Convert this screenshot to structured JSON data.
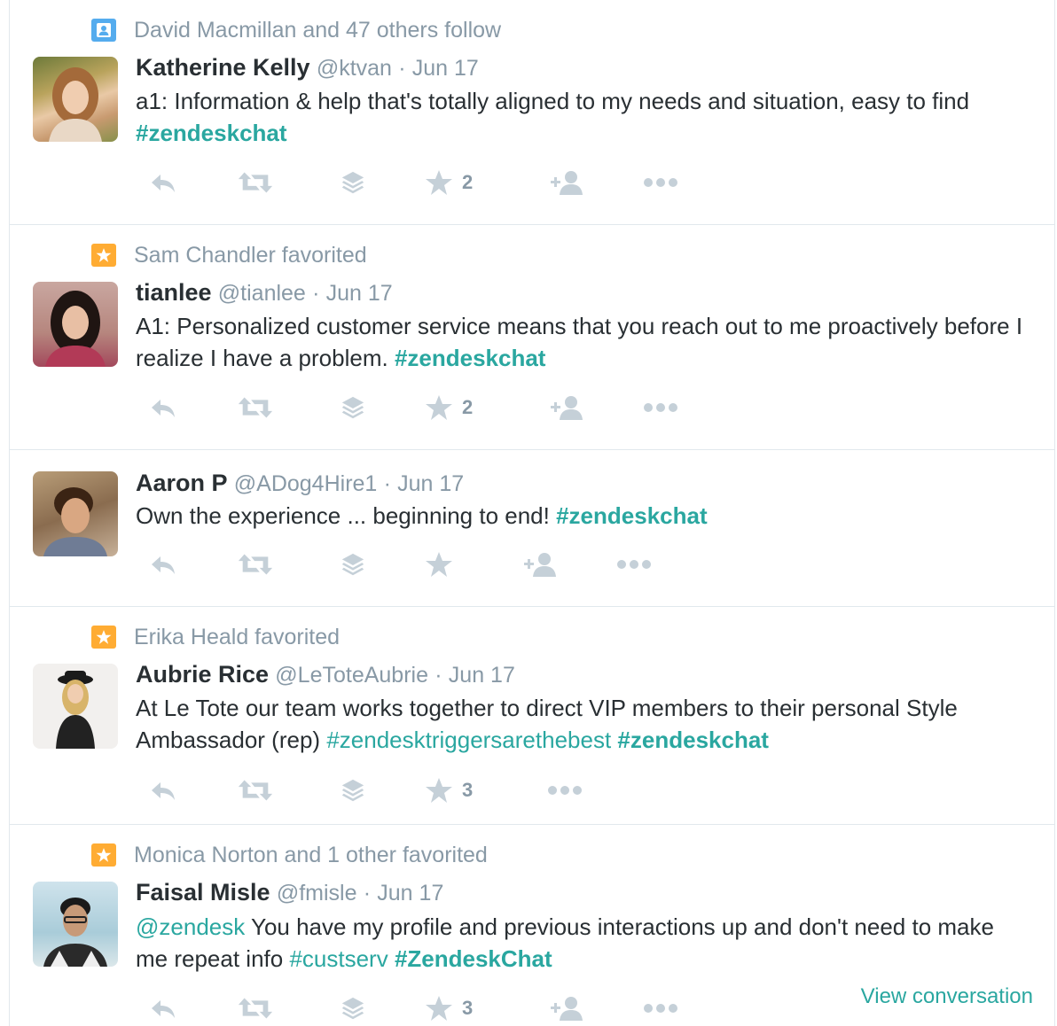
{
  "tweets": [
    {
      "context": {
        "kind": "follow",
        "text": "David Macmillan and 47 others follow"
      },
      "name": "Katherine Kelly",
      "handle": "@ktvan",
      "date": "Jun 17",
      "text_plain": "a1: Information & help that's totally aligned to my needs and situation, easy to find ",
      "hashtag": "#zendeskchat",
      "favorites": "2"
    },
    {
      "context": {
        "kind": "favorite",
        "text": "Sam Chandler favorited"
      },
      "name": "tianlee",
      "handle": "@tianlee",
      "date": "Jun 17",
      "text_plain": "A1: Personalized customer service means that you reach out to me proactively before I realize I have a problem. ",
      "hashtag": "#zendeskchat",
      "favorites": "2"
    },
    {
      "name": "Aaron P",
      "handle": "@ADog4Hire1",
      "date": "Jun 17",
      "text_plain": "Own the experience ... beginning to end! ",
      "hashtag": "#zendeskchat"
    },
    {
      "context": {
        "kind": "favorite",
        "text": "Erika Heald favorited"
      },
      "name": "Aubrie Rice",
      "handle": "@LeToteAubrie",
      "date": "Jun 17",
      "text_plain": "At Le Tote our team works together to direct VIP members to their personal Style Ambassador (rep) ",
      "hashtag1": "#zendesktriggersarethebest",
      "hashtag": "#zendeskchat",
      "favorites": "3"
    },
    {
      "context": {
        "kind": "favorite",
        "text": "Monica Norton and 1 other favorited"
      },
      "name": "Faisal Misle",
      "handle": "@fmisle",
      "date": "Jun 17",
      "mention": "@zendesk",
      "text_plain": " You have my profile and previous interactions up and don't need to make me repeat info ",
      "hashtag1": "#custserv",
      "hashtag": "#ZendeskChat",
      "favorites": "3",
      "view_conversation": "View conversation"
    }
  ],
  "separator": "·",
  "colors": {
    "accent": "#2aa7a0",
    "muted": "#8899a6",
    "follow_badge": "#55acee",
    "fav_badge": "#ffac33",
    "text": "#292f33"
  },
  "icons": [
    "reply-icon",
    "retweet-icon",
    "buffer-icon",
    "star-icon",
    "follow-icon",
    "more-icon"
  ]
}
